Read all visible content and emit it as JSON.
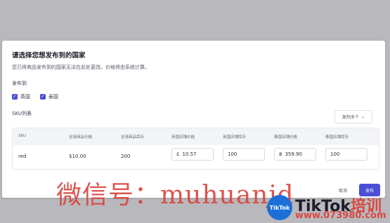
{
  "dialog": {
    "title": "请选择您想发布到的国家",
    "subtitle": "您已将商品发布到的国家无法在此处更改。价格将由系统计算。",
    "publish_to_label": "发布到",
    "countries": [
      {
        "label": "英国",
        "checked": true
      },
      {
        "label": "泰国",
        "checked": true
      }
    ],
    "sku_list_label": "SKU列表",
    "copy_button": "复制多个",
    "table": {
      "headers": [
        "SKU",
        "全球商品价格",
        "全球商品库存",
        "英国店铺价格",
        "英国店铺库存",
        "泰国店铺价格",
        "泰国店铺库存"
      ],
      "row": {
        "sku": "red",
        "global_price": "$10.00",
        "global_stock": "200",
        "uk_currency": "£",
        "uk_price": "10.57",
        "uk_stock": "100",
        "th_currency": "฿",
        "th_price": "359.90",
        "th_stock": "100"
      }
    },
    "cancel_button": "取消",
    "publish_button": "发布"
  },
  "watermark": {
    "text": "微信号：muhuanjd",
    "logo_text": "TikTok",
    "brand_text": "TikTok",
    "brand_suffix": "培训",
    "url": "www.073980.com"
  }
}
